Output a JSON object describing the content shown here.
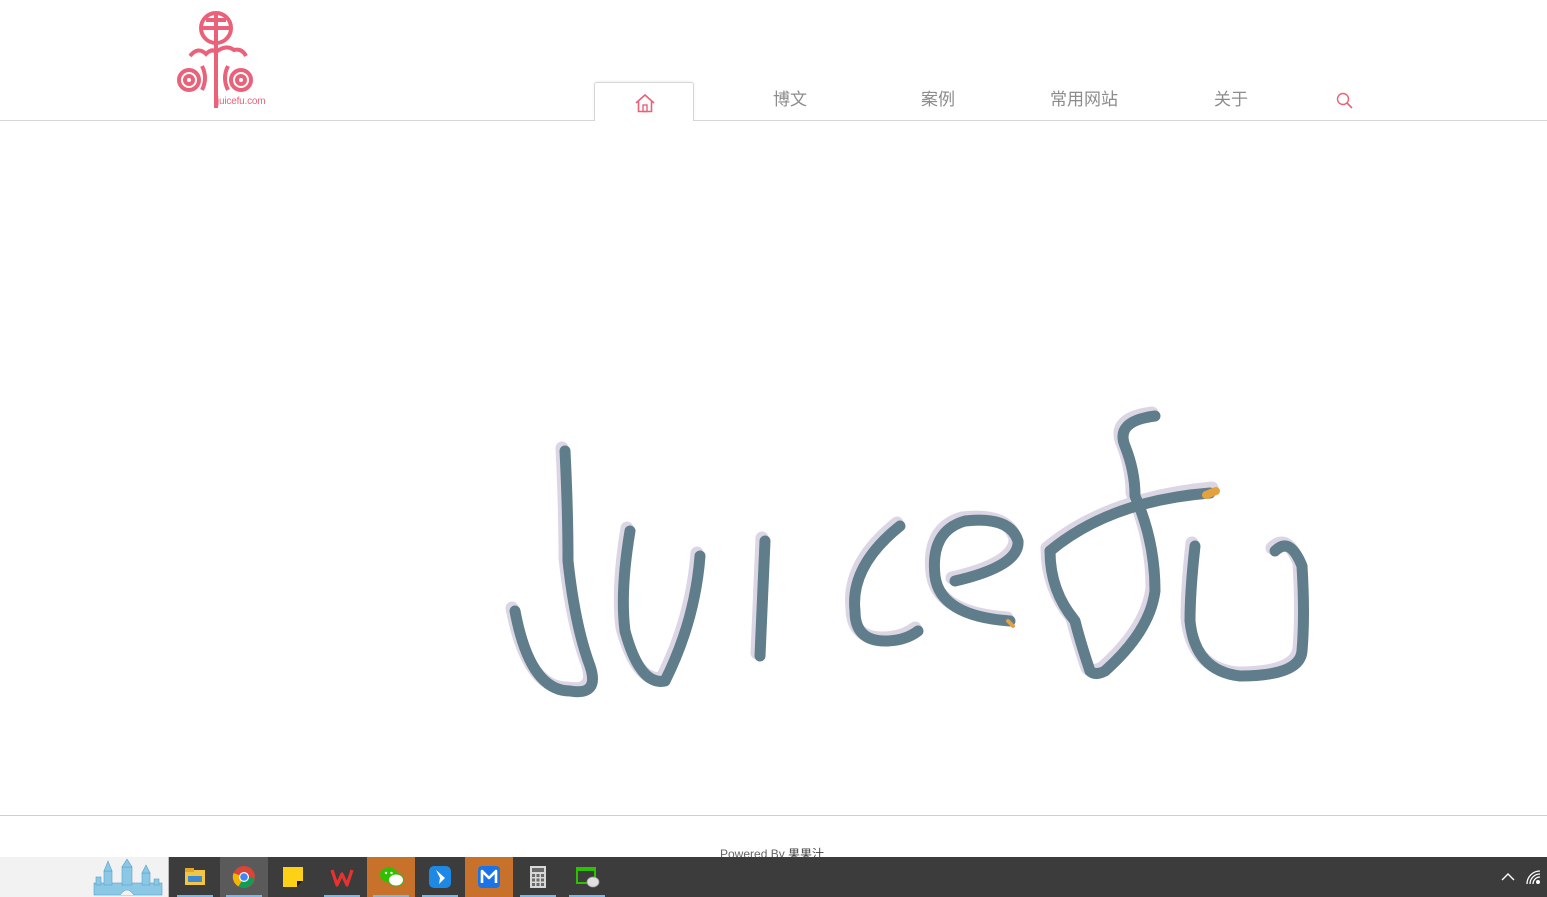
{
  "header": {
    "logo_caption": "juicefu.com",
    "brand_color": "#e9627a"
  },
  "nav": {
    "home_icon": "home-icon",
    "items": [
      {
        "label": "博文"
      },
      {
        "label": "案例"
      },
      {
        "label": "常用网站"
      },
      {
        "label": "关于"
      }
    ],
    "search_icon": "search-icon"
  },
  "main": {
    "signature_text": "Juicefu",
    "signature_color": "#607d8b"
  },
  "footer": {
    "powered_prefix": "Powered By ",
    "author": "果果汁"
  },
  "taskbar": {
    "apps": [
      {
        "icon": "file-explorer-icon"
      },
      {
        "icon": "chrome-icon"
      },
      {
        "icon": "sticky-notes-icon"
      },
      {
        "icon": "wps-office-icon"
      },
      {
        "icon": "wechat-icon"
      },
      {
        "icon": "feishu-icon"
      },
      {
        "icon": "mail-icon"
      },
      {
        "icon": "calculator-icon"
      },
      {
        "icon": "wechat-devtools-icon"
      }
    ],
    "tray": [
      "chevron-up-icon",
      "network-icon"
    ]
  }
}
